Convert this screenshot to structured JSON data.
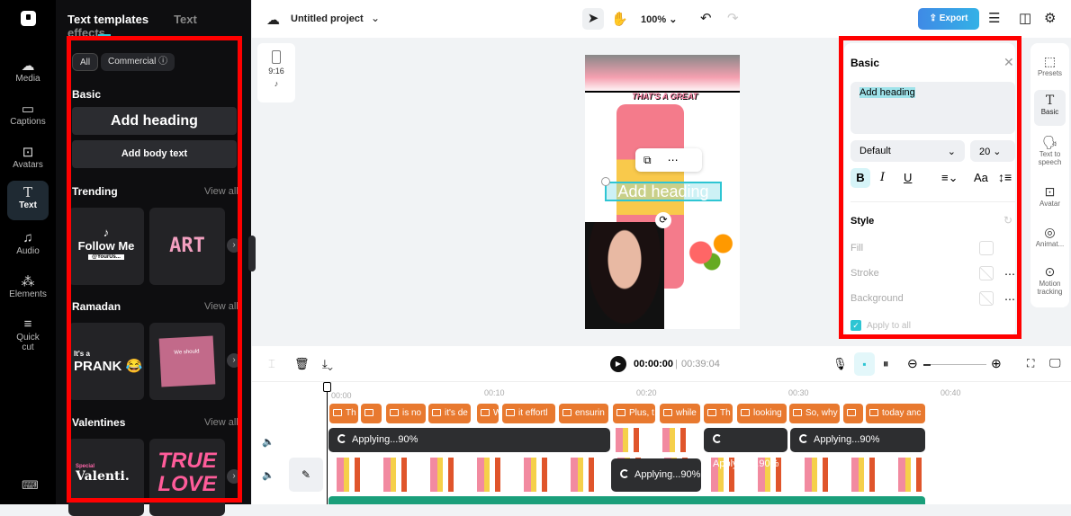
{
  "rail": {
    "items": [
      {
        "label": "Media",
        "icon": "cloud-upload-icon"
      },
      {
        "label": "Captions",
        "icon": "captions-icon"
      },
      {
        "label": "Avatars",
        "icon": "avatar-icon"
      },
      {
        "label": "Text",
        "icon": "text-icon"
      },
      {
        "label": "Audio",
        "icon": "music-icon"
      },
      {
        "label": "Elements",
        "icon": "elements-icon"
      },
      {
        "label": "Quick",
        "label2": "cut",
        "icon": "quick-cut-icon"
      }
    ]
  },
  "panel": {
    "tabs": [
      "Text templates",
      "Text effects"
    ],
    "filters": [
      "All",
      "Commercial"
    ],
    "basic": {
      "title": "Basic",
      "heading": "Add heading",
      "body": "Add body text"
    },
    "sections": [
      {
        "title": "Trending",
        "view_all": "View all",
        "cards": [
          "Follow Me",
          "ART"
        ],
        "card_sub": "@YourUs..."
      },
      {
        "title": "Ramadan",
        "view_all": "View all",
        "cards": [
          "PRANK",
          "We should"
        ],
        "card_pre": "It's a"
      },
      {
        "title": "Valentines",
        "view_all": "View all",
        "cards": [
          "Valenti.",
          "TRUE LOVE"
        ],
        "card_pre": "Special"
      }
    ]
  },
  "topbar": {
    "project": "Untitled project",
    "zoom": "100%",
    "export": "Export"
  },
  "aspect": {
    "ratio": "9:16"
  },
  "video": {
    "overlay": "THAT'S A GREAT",
    "selected_text": "Add heading"
  },
  "rpanel": {
    "title": "Basic",
    "text_value": "Add heading",
    "font": "Default",
    "size": "20",
    "style_title": "Style",
    "fill": "Fill",
    "stroke": "Stroke",
    "background": "Background",
    "apply_all": "Apply to all"
  },
  "rrail": [
    {
      "label": "Presets"
    },
    {
      "label": "Basic"
    },
    {
      "label": "Text to speech"
    },
    {
      "label": "Avatar"
    },
    {
      "label": "Animat..."
    },
    {
      "label": "Motion tracking"
    }
  ],
  "timeline": {
    "current": "00:00:00",
    "total": "00:39:04",
    "ticks": [
      "00:00",
      "00:10",
      "00:20",
      "00:30",
      "00:40"
    ],
    "captions": [
      "Th",
      "",
      "is no",
      "it's de",
      "W",
      "it effortl",
      "ensurin",
      "Plus, t",
      "while",
      "Th",
      "looking",
      "So, why",
      "",
      "today anc"
    ],
    "applying": "Applying...90%"
  }
}
